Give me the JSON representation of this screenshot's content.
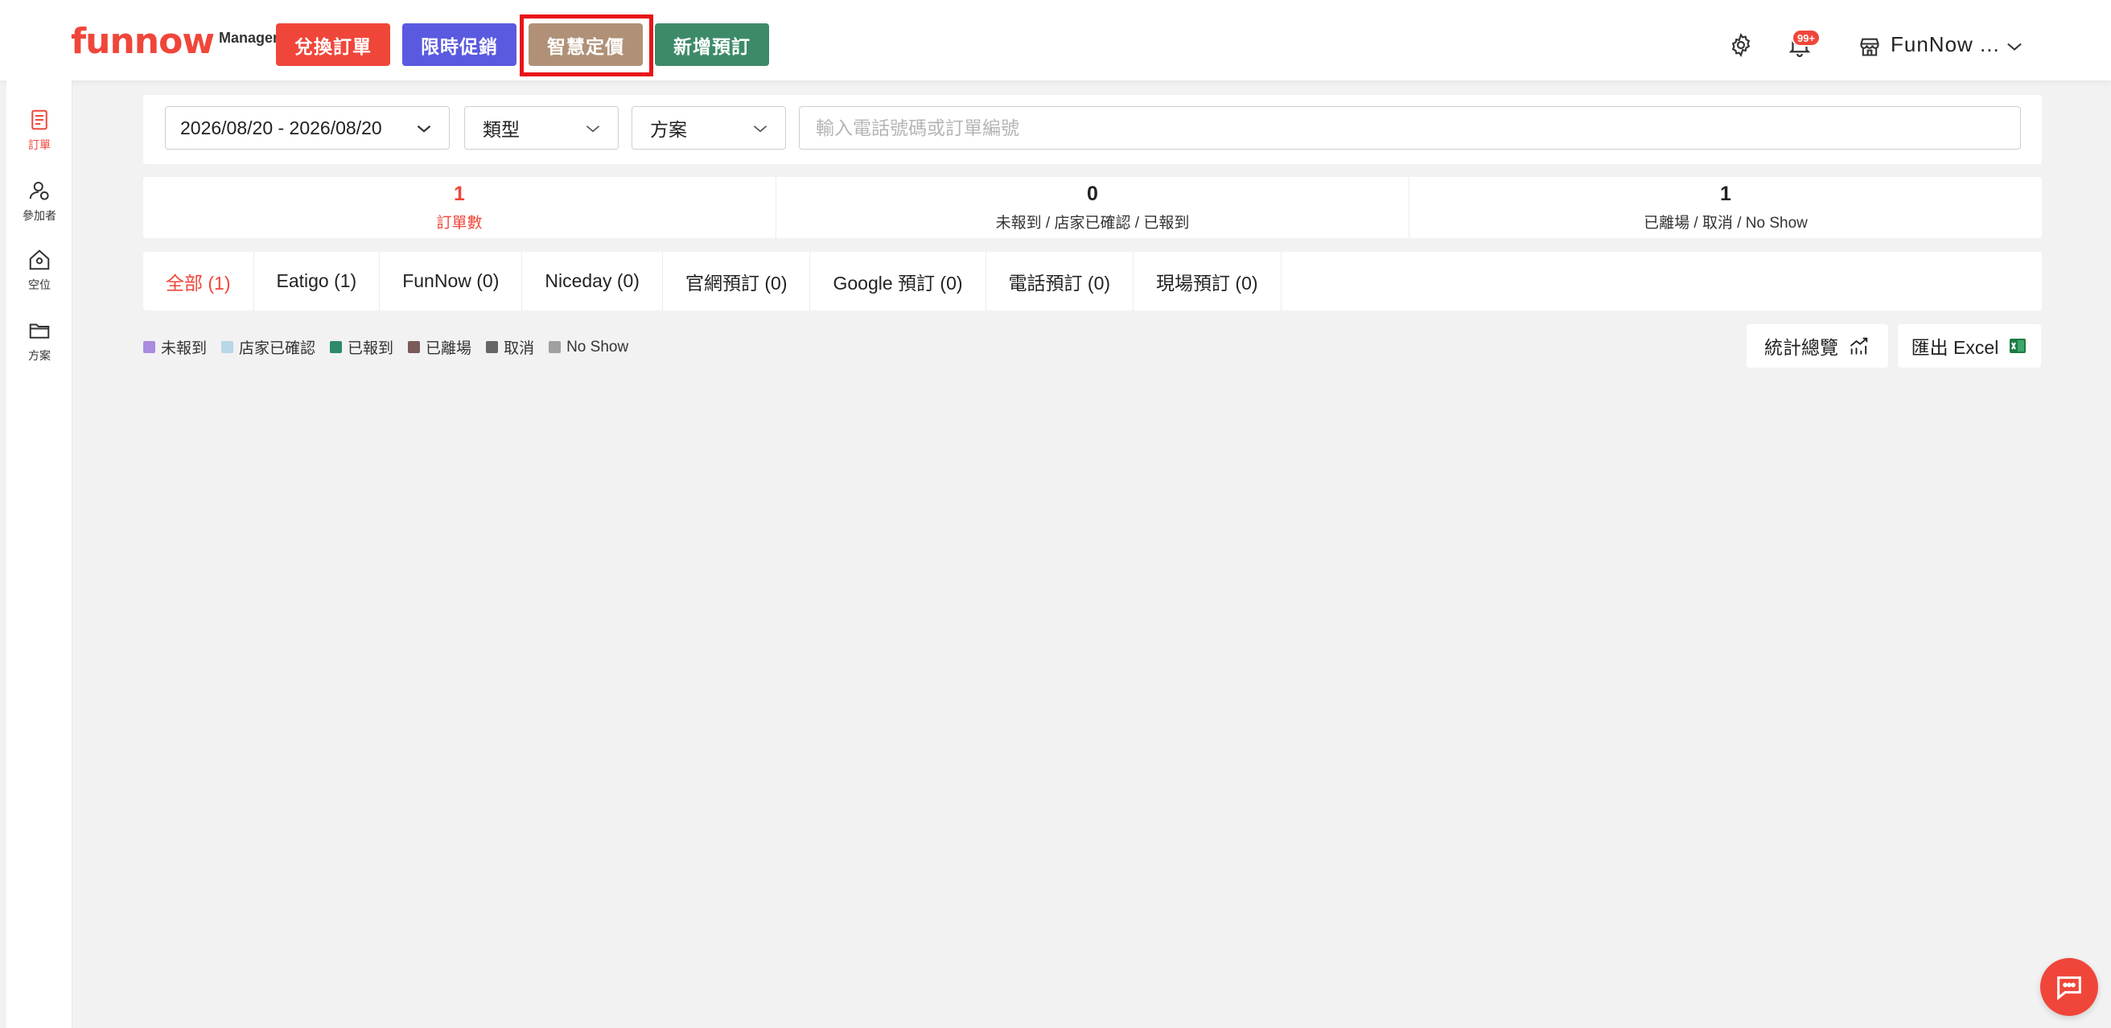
{
  "header": {
    "logo_main": "funnow",
    "logo_sub": "Manager",
    "buttons": {
      "redeem": "兌換訂單",
      "flash_sale": "限時促銷",
      "smart_pricing": "智慧定價",
      "new_booking": "新增預訂"
    },
    "notification_badge": "99+",
    "store_name": "FunNow ...",
    "colors": {
      "brand_red": "#f0463a",
      "blue": "#5a5ae0",
      "tan": "#b09177",
      "green": "#3d8a68",
      "highlight": "#e8141a"
    }
  },
  "sidebar": {
    "items": [
      {
        "label": "訂單",
        "icon": "document-icon"
      },
      {
        "label": "參加者",
        "icon": "user-icon"
      },
      {
        "label": "空位",
        "icon": "home-icon"
      },
      {
        "label": "方案",
        "icon": "folder-icon"
      }
    ]
  },
  "filters": {
    "date_range": "2026/08/20 - 2026/08/20",
    "type": "類型",
    "plan": "方案",
    "search_placeholder": "輸入電話號碼或訂單編號"
  },
  "stats": [
    {
      "value": "1",
      "label": "訂單數"
    },
    {
      "value": "0",
      "label": "未報到 / 店家已確認 / 已報到"
    },
    {
      "value": "1",
      "label": "已離場 / 取消 / No Show"
    }
  ],
  "tabs": [
    "全部 (1)",
    "Eatigo (1)",
    "FunNow (0)",
    "Niceday (0)",
    "官網預訂 (0)",
    "Google 預訂 (0)",
    "電話預訂 (0)",
    "現場預訂 (0)"
  ],
  "legend": [
    {
      "label": "未報到",
      "color": "#a98be0"
    },
    {
      "label": "店家已確認",
      "color": "#b9d7e6"
    },
    {
      "label": "已報到",
      "color": "#2e8a68"
    },
    {
      "label": "已離場",
      "color": "#7a5a5a"
    },
    {
      "label": "取消",
      "color": "#666666"
    },
    {
      "label": "No Show",
      "color": "#a0a0a0"
    }
  ],
  "actions": {
    "stats_overview": "統計總覽",
    "export_excel": "匯出 Excel"
  }
}
